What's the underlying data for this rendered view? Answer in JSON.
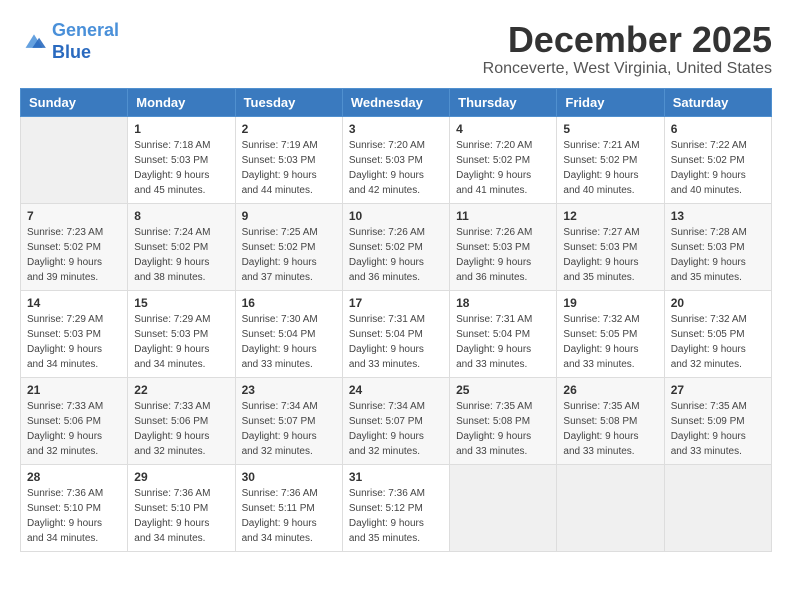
{
  "header": {
    "logo_line1": "General",
    "logo_line2": "Blue",
    "month_year": "December 2025",
    "location": "Ronceverte, West Virginia, United States"
  },
  "weekdays": [
    "Sunday",
    "Monday",
    "Tuesday",
    "Wednesday",
    "Thursday",
    "Friday",
    "Saturday"
  ],
  "weeks": [
    [
      {
        "day": "",
        "sunrise": "",
        "sunset": "",
        "daylight": ""
      },
      {
        "day": "1",
        "sunrise": "Sunrise: 7:18 AM",
        "sunset": "Sunset: 5:03 PM",
        "daylight": "Daylight: 9 hours and 45 minutes."
      },
      {
        "day": "2",
        "sunrise": "Sunrise: 7:19 AM",
        "sunset": "Sunset: 5:03 PM",
        "daylight": "Daylight: 9 hours and 44 minutes."
      },
      {
        "day": "3",
        "sunrise": "Sunrise: 7:20 AM",
        "sunset": "Sunset: 5:03 PM",
        "daylight": "Daylight: 9 hours and 42 minutes."
      },
      {
        "day": "4",
        "sunrise": "Sunrise: 7:20 AM",
        "sunset": "Sunset: 5:02 PM",
        "daylight": "Daylight: 9 hours and 41 minutes."
      },
      {
        "day": "5",
        "sunrise": "Sunrise: 7:21 AM",
        "sunset": "Sunset: 5:02 PM",
        "daylight": "Daylight: 9 hours and 40 minutes."
      },
      {
        "day": "6",
        "sunrise": "Sunrise: 7:22 AM",
        "sunset": "Sunset: 5:02 PM",
        "daylight": "Daylight: 9 hours and 40 minutes."
      }
    ],
    [
      {
        "day": "7",
        "sunrise": "Sunrise: 7:23 AM",
        "sunset": "Sunset: 5:02 PM",
        "daylight": "Daylight: 9 hours and 39 minutes."
      },
      {
        "day": "8",
        "sunrise": "Sunrise: 7:24 AM",
        "sunset": "Sunset: 5:02 PM",
        "daylight": "Daylight: 9 hours and 38 minutes."
      },
      {
        "day": "9",
        "sunrise": "Sunrise: 7:25 AM",
        "sunset": "Sunset: 5:02 PM",
        "daylight": "Daylight: 9 hours and 37 minutes."
      },
      {
        "day": "10",
        "sunrise": "Sunrise: 7:26 AM",
        "sunset": "Sunset: 5:02 PM",
        "daylight": "Daylight: 9 hours and 36 minutes."
      },
      {
        "day": "11",
        "sunrise": "Sunrise: 7:26 AM",
        "sunset": "Sunset: 5:03 PM",
        "daylight": "Daylight: 9 hours and 36 minutes."
      },
      {
        "day": "12",
        "sunrise": "Sunrise: 7:27 AM",
        "sunset": "Sunset: 5:03 PM",
        "daylight": "Daylight: 9 hours and 35 minutes."
      },
      {
        "day": "13",
        "sunrise": "Sunrise: 7:28 AM",
        "sunset": "Sunset: 5:03 PM",
        "daylight": "Daylight: 9 hours and 35 minutes."
      }
    ],
    [
      {
        "day": "14",
        "sunrise": "Sunrise: 7:29 AM",
        "sunset": "Sunset: 5:03 PM",
        "daylight": "Daylight: 9 hours and 34 minutes."
      },
      {
        "day": "15",
        "sunrise": "Sunrise: 7:29 AM",
        "sunset": "Sunset: 5:03 PM",
        "daylight": "Daylight: 9 hours and 34 minutes."
      },
      {
        "day": "16",
        "sunrise": "Sunrise: 7:30 AM",
        "sunset": "Sunset: 5:04 PM",
        "daylight": "Daylight: 9 hours and 33 minutes."
      },
      {
        "day": "17",
        "sunrise": "Sunrise: 7:31 AM",
        "sunset": "Sunset: 5:04 PM",
        "daylight": "Daylight: 9 hours and 33 minutes."
      },
      {
        "day": "18",
        "sunrise": "Sunrise: 7:31 AM",
        "sunset": "Sunset: 5:04 PM",
        "daylight": "Daylight: 9 hours and 33 minutes."
      },
      {
        "day": "19",
        "sunrise": "Sunrise: 7:32 AM",
        "sunset": "Sunset: 5:05 PM",
        "daylight": "Daylight: 9 hours and 33 minutes."
      },
      {
        "day": "20",
        "sunrise": "Sunrise: 7:32 AM",
        "sunset": "Sunset: 5:05 PM",
        "daylight": "Daylight: 9 hours and 32 minutes."
      }
    ],
    [
      {
        "day": "21",
        "sunrise": "Sunrise: 7:33 AM",
        "sunset": "Sunset: 5:06 PM",
        "daylight": "Daylight: 9 hours and 32 minutes."
      },
      {
        "day": "22",
        "sunrise": "Sunrise: 7:33 AM",
        "sunset": "Sunset: 5:06 PM",
        "daylight": "Daylight: 9 hours and 32 minutes."
      },
      {
        "day": "23",
        "sunrise": "Sunrise: 7:34 AM",
        "sunset": "Sunset: 5:07 PM",
        "daylight": "Daylight: 9 hours and 32 minutes."
      },
      {
        "day": "24",
        "sunrise": "Sunrise: 7:34 AM",
        "sunset": "Sunset: 5:07 PM",
        "daylight": "Daylight: 9 hours and 32 minutes."
      },
      {
        "day": "25",
        "sunrise": "Sunrise: 7:35 AM",
        "sunset": "Sunset: 5:08 PM",
        "daylight": "Daylight: 9 hours and 33 minutes."
      },
      {
        "day": "26",
        "sunrise": "Sunrise: 7:35 AM",
        "sunset": "Sunset: 5:08 PM",
        "daylight": "Daylight: 9 hours and 33 minutes."
      },
      {
        "day": "27",
        "sunrise": "Sunrise: 7:35 AM",
        "sunset": "Sunset: 5:09 PM",
        "daylight": "Daylight: 9 hours and 33 minutes."
      }
    ],
    [
      {
        "day": "28",
        "sunrise": "Sunrise: 7:36 AM",
        "sunset": "Sunset: 5:10 PM",
        "daylight": "Daylight: 9 hours and 34 minutes."
      },
      {
        "day": "29",
        "sunrise": "Sunrise: 7:36 AM",
        "sunset": "Sunset: 5:10 PM",
        "daylight": "Daylight: 9 hours and 34 minutes."
      },
      {
        "day": "30",
        "sunrise": "Sunrise: 7:36 AM",
        "sunset": "Sunset: 5:11 PM",
        "daylight": "Daylight: 9 hours and 34 minutes."
      },
      {
        "day": "31",
        "sunrise": "Sunrise: 7:36 AM",
        "sunset": "Sunset: 5:12 PM",
        "daylight": "Daylight: 9 hours and 35 minutes."
      },
      {
        "day": "",
        "sunrise": "",
        "sunset": "",
        "daylight": ""
      },
      {
        "day": "",
        "sunrise": "",
        "sunset": "",
        "daylight": ""
      },
      {
        "day": "",
        "sunrise": "",
        "sunset": "",
        "daylight": ""
      }
    ]
  ]
}
